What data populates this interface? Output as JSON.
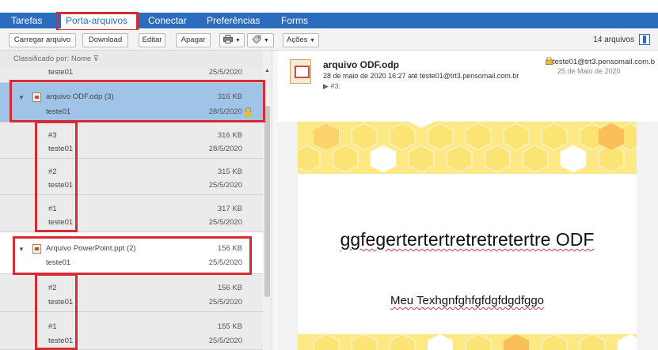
{
  "nav": {
    "tabs": [
      {
        "label": "Tarefas"
      },
      {
        "label": "Porta-arquivos"
      },
      {
        "label": "Conectar"
      },
      {
        "label": "Preferências"
      },
      {
        "label": "Forms"
      }
    ]
  },
  "toolbar": {
    "upload": "Carregar arquivo",
    "download": "Download",
    "edit": "Editar",
    "delete": "Apagar",
    "actions": "Ações",
    "file_count": "14 arquivos"
  },
  "list": {
    "sort_label": "Classificado por: Nome",
    "rows": [
      {
        "name": "teste01",
        "size": "",
        "owner": "",
        "date": "25/5/2020"
      },
      {
        "name": "arquivo ODF.odp (3)",
        "size": "316 KB",
        "owner": "teste01",
        "date": "28/5/2020"
      },
      {
        "name": "#3",
        "size": "316 KB",
        "owner": "teste01",
        "date": "28/5/2020"
      },
      {
        "name": "#2",
        "size": "315 KB",
        "owner": "teste01",
        "date": "25/5/2020"
      },
      {
        "name": "#1",
        "size": "317 KB",
        "owner": "teste01",
        "date": "25/5/2020"
      },
      {
        "name": "Arquivo PowerPoint.ppt (2)",
        "size": "156 KB",
        "owner": "teste01",
        "date": "25/5/2020"
      },
      {
        "name": "#2",
        "size": "156 KB",
        "owner": "teste01",
        "date": "25/5/2020"
      },
      {
        "name": "#1",
        "size": "155 KB",
        "owner": "teste01",
        "date": "25/5/2020"
      }
    ]
  },
  "preview": {
    "file_name": "arquivo ODF.odp",
    "info": "28 de maio de 2020 16:27 até teste01@trt3.pensomail.com.br",
    "version": "▶ #3:",
    "owner": "teste01@trt3.pensomail.com.b",
    "owner_date": "25 de Maio de 2020",
    "slide_title": "ggfegertertertretretretertre ODF",
    "slide_body": "Meu Texhgnfghfgfdgfdgdfggo"
  },
  "colors": {
    "accent": "#2b6cbf",
    "selected": "#9fc4e8",
    "annotation": "#d62b34",
    "honeycomb": "#fde883"
  }
}
